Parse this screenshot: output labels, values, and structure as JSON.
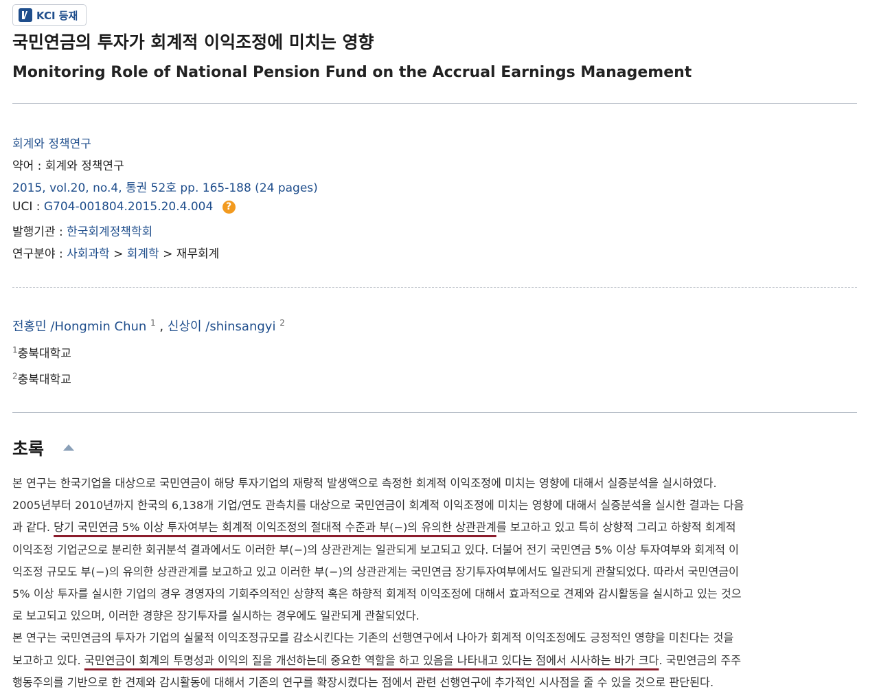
{
  "badge": {
    "label": "KCI 등재",
    "icon": "kci-logo-icon"
  },
  "title_ko": "국민연금의 투자가 회계적 이익조정에 미치는 영향",
  "title_en": "Monitoring Role of National Pension Fund on the Accrual Earnings Management",
  "journal": {
    "name": "회계와 정책연구",
    "abbr_label": "약어 :",
    "abbr": "회계와 정책연구",
    "issue": "2015, vol.20, no.4, 통권 52호 pp. 165-188 (24 pages)",
    "uci_label": "UCI :",
    "uci": "G704-001804.2015.20.4.004",
    "uci_help_icon": "question-circle-icon",
    "publisher_label": "발행기관 :",
    "publisher": "한국회계정책학회",
    "field_label": "연구분야 :",
    "field_1": "사회과학",
    "field_2": "회계학",
    "field_3": "재무회계",
    "sep": ">"
  },
  "authors": [
    {
      "name": "전홍민 /Hongmin Chun",
      "num": "1"
    },
    {
      "name": "신상이 /shinsangyi",
      "num": "2"
    }
  ],
  "author_sep": ",",
  "affiliations": [
    {
      "num": "1",
      "name": "충북대학교"
    },
    {
      "num": "2",
      "name": "충북대학교"
    }
  ],
  "abstract": {
    "heading": "초록",
    "lines": [
      {
        "a": "본 연구는 한국기업을 대상으로 국민연금이 해당 투자기업의 재량적 발생액으로 측정한 회계적 이익조정에 미치는 영향에 대해서 실증분석을 실시하였다."
      },
      {
        "a": "2005년부터 2010년까지 한국의 6,138개 기업/연도 관측치를 대상으로 국민연금이 회계적 이익조정에 미치는 영향에 대해서 실증분석을 실시한 결과는 다음"
      },
      {
        "a": "과 같다. ",
        "u": "당기 국민연금 5% 이상 투자여부는 회계적 이익조정의 절대적 수준과 부(−)의 유의한 상관관계",
        "b": "를 보고하고 있고 특히 상향적 그리고 하향적 회계적"
      },
      {
        "a": "이익조정 기업군으로 분리한 회귀분석 결과에서도 이러한 부(−)의 상관관계는 일관되게 보고되고 있다. 더불어 전기 국민연금 5% 이상 투자여부와 회계적 이"
      },
      {
        "a": "익조정 규모도 부(−)의 유의한 상관관계를 보고하고 있고 이러한 부(−)의 상관관계는 국민연금 장기투자여부에서도 일관되게 관찰되었다. 따라서 국민연금이"
      },
      {
        "a": "5% 이상 투자를 실시한 기업의 경우 경영자의 기회주의적인 상향적 혹은 하향적 회계적 이익조정에 대해서 효과적으로 견제와 감시활동을 실시하고 있는 것으"
      },
      {
        "a": "로 보고되고 있으며, 이러한 경향은 장기투자를 실시하는 경우에도 일관되게 관찰되었다."
      },
      {
        "a": "본 연구는 국민연금의 투자가 기업의 실물적 이익조정규모를 감소시킨다는 기존의 선행연구에서 나아가 회계적 이익조정에도 긍정적인 영향을 미친다는 것을"
      },
      {
        "a": "보고하고 있다. ",
        "u": "국민연금이 회계의 투명성과 이익의 질을 개선하는데 중요한 역할을 하고 있음을 나타내고 있다는 점에서 시사하는 바가 크다",
        "b": ". 국민연금의 주주"
      },
      {
        "a": "행동주의를 기반으로 한 견제와 감시활동에 대해서 기존의 연구를 확장시켰다는 점에서 관련 선행연구에 추가적인 시사점을 줄 수 있을 것으로 판단된다."
      }
    ]
  },
  "colors": {
    "link": "#1f4e8c",
    "underline": "#8b1d2c",
    "help": "#f29a1f"
  }
}
